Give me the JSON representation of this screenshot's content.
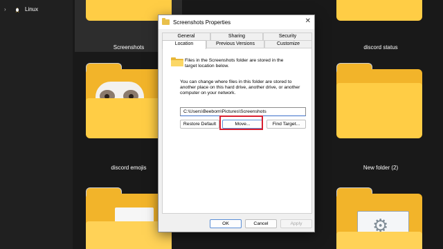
{
  "nav": {
    "chevron_glyph": "›",
    "linux_label": "Linux",
    "linux_icon": "linux-penguin-icon"
  },
  "folders": {
    "top_left_label": "Screenshots",
    "top_right_label": "discord status",
    "middle_left_label": "discord emojis",
    "middle_right_label": "New folder (2)"
  },
  "dialog": {
    "title": "Screenshots Properties",
    "close_glyph": "✕",
    "tabs_row1": [
      "General",
      "Sharing",
      "Security"
    ],
    "tabs_row2": [
      "Location",
      "Previous Versions",
      "Customize"
    ],
    "active_tab": "Location",
    "info_line1": "Files in the Screenshots folder are stored in the",
    "info_line2": "target location below.",
    "desc_line1": "You can change where files in this folder are stored to",
    "desc_line2": "another place on this hard drive, another drive, or another",
    "desc_line3": "computer on your network.",
    "path_value": "C:\\Users\\Beebom\\Pictures\\Screenshots",
    "restore_default_label": "Restore Default",
    "move_label": "Move...",
    "find_target_label": "Find Target...",
    "ok_label": "OK",
    "cancel_label": "Cancel",
    "apply_label": "Apply"
  },
  "colors": {
    "highlight": "#d81e2f",
    "folder": "#ffcd45",
    "dialog_bg": "#f0f0f0"
  }
}
